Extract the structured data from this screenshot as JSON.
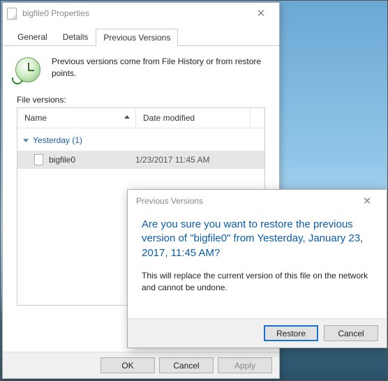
{
  "props": {
    "title": "bigfile0 Properties",
    "close": "✕",
    "tabs": {
      "general": "General",
      "details": "Details",
      "previous": "Previous Versions"
    },
    "intro": "Previous versions come from File History or from restore points.",
    "section_label": "File versions:",
    "columns": {
      "name": "Name",
      "date": "Date modified"
    },
    "group_label": "Yesterday (1)",
    "item": {
      "name": "bigfile0",
      "date": "1/23/2017 11:45 AM"
    },
    "buttons": {
      "ok": "OK",
      "cancel": "Cancel",
      "apply": "Apply"
    }
  },
  "confirm": {
    "title": "Previous Versions",
    "close": "✕",
    "main": "Are you sure you want to restore the previous version of \"bigfile0\" from Yesterday, ‎January ‎23, ‎2017, ‏‎11:45 AM?",
    "sub": "This will replace the current version of this file on the network and cannot be undone.",
    "restore": "Restore",
    "cancel": "Cancel"
  }
}
